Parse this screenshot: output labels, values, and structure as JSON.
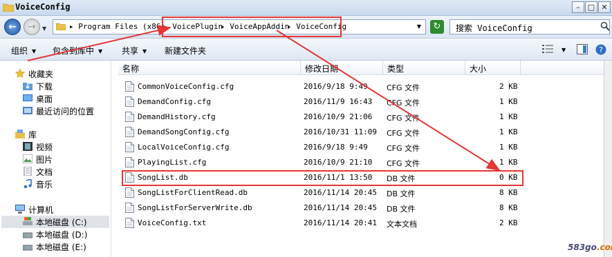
{
  "window": {
    "title": "VoiceConfig",
    "controls": [
      "–",
      "□",
      "✕"
    ]
  },
  "address": {
    "crumbs": [
      "▸ Program Files (x86)",
      "▸ VoicePlugin",
      "▸ VoiceAppAddin",
      "▸ VoiceConfig"
    ],
    "search_placeholder": "搜索 VoiceConfig"
  },
  "toolbar": {
    "organize": "组织",
    "include_library": "包含到库中",
    "share": "共享",
    "new_folder": "新建文件夹"
  },
  "navpane": {
    "favorites": {
      "label": "收藏夹",
      "items": [
        "下载",
        "桌面",
        "最近访问的位置"
      ]
    },
    "libraries": {
      "label": "库",
      "items": [
        "视频",
        "图片",
        "文档",
        "音乐"
      ]
    },
    "computer": {
      "label": "计算机",
      "items": [
        "本地磁盘 (C:)",
        "本地磁盘 (D:)",
        "本地磁盘 (E:)"
      ]
    }
  },
  "table": {
    "headers": [
      "名称",
      "修改日期",
      "类型",
      "大小"
    ],
    "rows": [
      {
        "name": "CommonVoiceConfig.cfg",
        "date": "2016/9/18 9:49",
        "type": "CFG 文件",
        "size": "2 KB"
      },
      {
        "name": "DemandConfig.cfg",
        "date": "2016/11/9 16:43",
        "type": "CFG 文件",
        "size": "1 KB"
      },
      {
        "name": "DemandHistory.cfg",
        "date": "2016/10/9 21:06",
        "type": "CFG 文件",
        "size": "1 KB"
      },
      {
        "name": "DemandSongConfig.cfg",
        "date": "2016/10/31 11:09",
        "type": "CFG 文件",
        "size": "1 KB"
      },
      {
        "name": "LocalVoiceConfig.cfg",
        "date": "2016/9/18 9:49",
        "type": "CFG 文件",
        "size": "1 KB"
      },
      {
        "name": "PlayingList.cfg",
        "date": "2016/10/9 21:10",
        "type": "CFG 文件",
        "size": "1 KB"
      },
      {
        "name": "SongList.db",
        "date": "2016/11/1 13:50",
        "type": "DB 文件",
        "size": "0 KB"
      },
      {
        "name": "SongListForClientRead.db",
        "date": "2016/11/14 20:45",
        "type": "DB 文件",
        "size": "8 KB"
      },
      {
        "name": "SongListForServerWrite.db",
        "date": "2016/11/14 20:45",
        "type": "DB 文件",
        "size": "8 KB"
      },
      {
        "name": "VoiceConfig.txt",
        "date": "2016/11/14 20:41",
        "type": "文本文档",
        "size": "2 KB"
      }
    ]
  },
  "watermark": {
    "prefix": "583go",
    "suffix": ".com"
  },
  "colors": {
    "highlight": "#e53535",
    "selection": "#dfe3e8"
  },
  "icons": [
    "folder-icon",
    "back-icon",
    "forward-icon",
    "refresh-icon",
    "search-icon",
    "star-icon",
    "library-icon",
    "computer-icon",
    "drive-icon",
    "file-icon",
    "help-icon"
  ]
}
